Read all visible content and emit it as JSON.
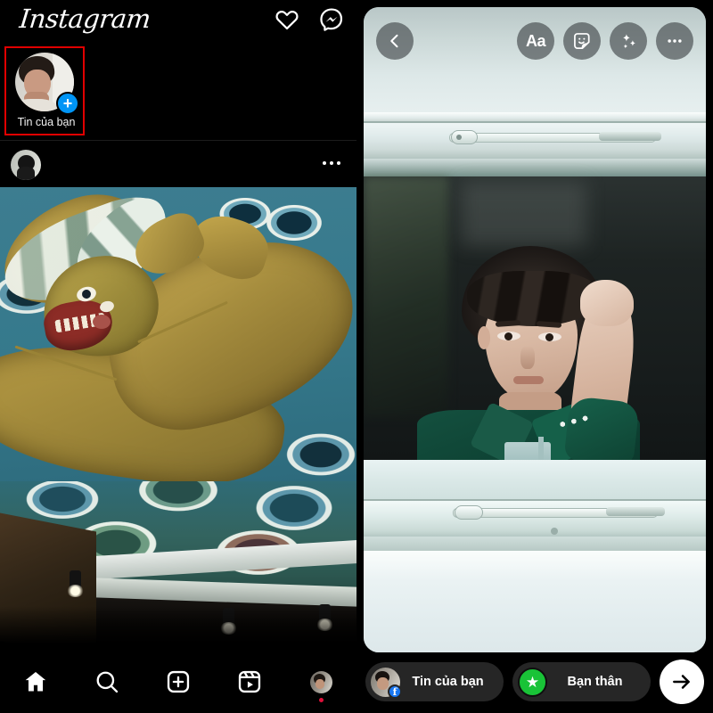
{
  "left_panel": {
    "app_name": "Instagram",
    "header_icons": [
      {
        "name": "heart-icon",
        "label": "Activity"
      },
      {
        "name": "messenger-icon",
        "label": "Messenger"
      }
    ],
    "stories": {
      "your_story_label": "Tin của bạn",
      "add_button": "+",
      "highlighted": true,
      "highlight_color": "#e00000"
    },
    "post": {
      "more_menu": "•••",
      "image_description": "Golden dragon ceiling mural on teal background"
    },
    "bottom_nav": [
      {
        "name": "home-icon",
        "label": "Home",
        "active": true
      },
      {
        "name": "search-icon",
        "label": "Search",
        "active": false
      },
      {
        "name": "add-post-icon",
        "label": "Create",
        "active": false
      },
      {
        "name": "reels-icon",
        "label": "Reels",
        "active": false
      },
      {
        "name": "profile-avatar",
        "label": "Profile",
        "active": false,
        "badge": true
      }
    ]
  },
  "right_panel": {
    "topbar": {
      "back": "‹",
      "actions": [
        {
          "name": "text-tool",
          "label": "Aa"
        },
        {
          "name": "sticker-tool",
          "label": "sticker-icon"
        },
        {
          "name": "effects-tool",
          "label": "sparkles-icon"
        },
        {
          "name": "more-tool",
          "label": "•••"
        }
      ]
    },
    "story_photo": {
      "description": "Portrait of a young man behind a pale blue window frame"
    },
    "bottombar": {
      "your_story_label": "Tin của bạn",
      "close_friends_label": "Bạn thân",
      "send_label": "→",
      "close_friends_color": "#19c337",
      "facebook_badge_color": "#1877f2"
    }
  },
  "colors": {
    "background": "#000000",
    "accent_blue": "#0095f6",
    "highlight_red": "#e00000",
    "pill_bg": "#262626"
  }
}
